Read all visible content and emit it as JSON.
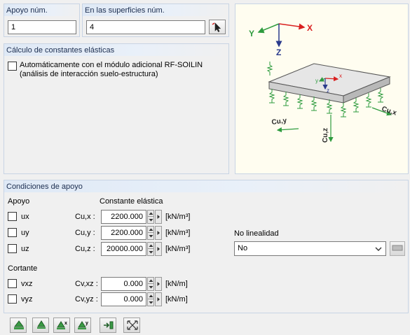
{
  "support_no": {
    "label": "Apoyo núm.",
    "value": "1"
  },
  "on_surfaces": {
    "label": "En las superficies núm.",
    "value": "4"
  },
  "elastic_constants": {
    "title": "Cálculo de constantes elásticas",
    "auto_checkbox_line1": "Automáticamente con el módulo adicional RF-SOILIN",
    "auto_checkbox_line2": "(análisis de interacción suelo-estructura)",
    "checked": false
  },
  "diagram": {
    "axis_y": "Y",
    "axis_x": "X",
    "axis_z": "Z",
    "small_y": "y",
    "small_x": "x",
    "small_z": "z",
    "cuy": "Cu,y",
    "cux": "Cu,x",
    "cuz": "Cu,z"
  },
  "conditions": {
    "title": "Condiciones de apoyo",
    "col_support": "Apoyo",
    "col_constant": "Constante elástica",
    "rows": [
      {
        "name": "ux",
        "const": "Cu,x :",
        "value": "2200.000",
        "unit": "[kN/m³]",
        "checked": false
      },
      {
        "name": "uy",
        "const": "Cu,y :",
        "value": "2200.000",
        "unit": "[kN/m³]",
        "checked": false
      },
      {
        "name": "uz",
        "const": "Cu,z :",
        "value": "20000.000",
        "unit": "[kN/m³]",
        "checked": false
      }
    ],
    "shear_label": "Cortante",
    "shear_rows": [
      {
        "name": "vxz",
        "const": "Cv,xz :",
        "value": "0.000",
        "unit": "[kN/m]",
        "checked": false
      },
      {
        "name": "vyz",
        "const": "Cv,yz :",
        "value": "0.000",
        "unit": "[kN/m]",
        "checked": false
      }
    ],
    "nonlinearity_label": "No linealidad",
    "nonlinearity_value": "No"
  },
  "toolbar": {
    "buttons": [
      "support-all-button",
      "support-free-button",
      "support-x-button",
      "support-y-button",
      "import-button",
      "reset-button"
    ]
  },
  "colors": {
    "accent": "#1b2d4f",
    "group_header": "#dfe9f6",
    "spring": "#2e9b3e",
    "axis_red": "#d92020",
    "axis_green": "#2e9b3e",
    "axis_blue": "#2a3a8c"
  }
}
